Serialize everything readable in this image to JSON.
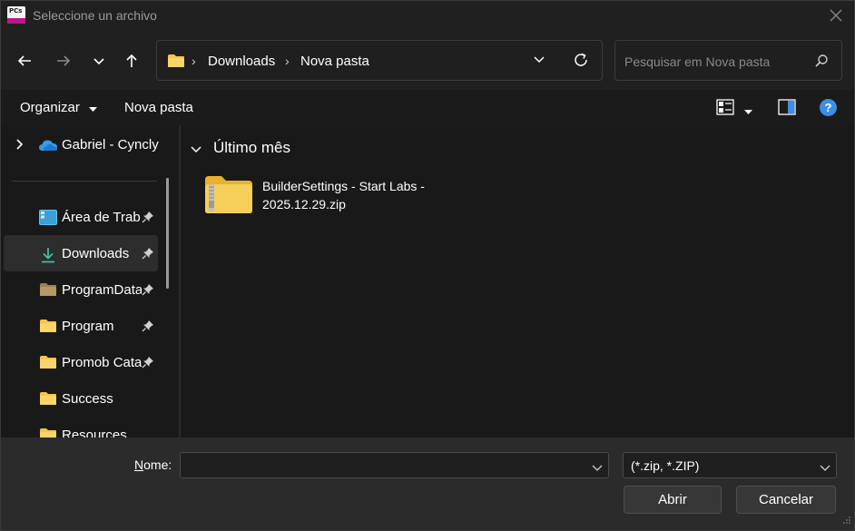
{
  "window": {
    "title": "Seleccione un archivo"
  },
  "address": {
    "crumbs": [
      "Downloads",
      "Nova pasta"
    ]
  },
  "search": {
    "placeholder": "Pesquisar em Nova pasta"
  },
  "toolbar": {
    "organize_label": "Organizar",
    "new_folder_label": "Nova pasta"
  },
  "sidebar": {
    "top_item": {
      "label": "Gabriel - Cyncly",
      "icon": "onedrive-cloud-icon"
    },
    "items": [
      {
        "label": "Área de Trab",
        "icon": "desktop-icon",
        "pinned": true,
        "active": false
      },
      {
        "label": "Downloads",
        "icon": "download-icon",
        "pinned": true,
        "active": true
      },
      {
        "label": "ProgramData",
        "icon": "folder-icon",
        "pinned": true,
        "active": false
      },
      {
        "label": "Program",
        "icon": "folder-icon",
        "pinned": true,
        "active": false
      },
      {
        "label": "Promob Cata",
        "icon": "folder-icon",
        "pinned": true,
        "active": false
      },
      {
        "label": "Success",
        "icon": "folder-icon",
        "pinned": false,
        "active": false
      },
      {
        "label": "Resources",
        "icon": "folder-icon",
        "pinned": false,
        "active": false
      }
    ]
  },
  "main": {
    "group_label": "Último mês",
    "files": [
      {
        "name_line1": "BuilderSettings - Start Labs -",
        "name_line2": "2025.12.29.zip",
        "icon": "zip-folder-icon"
      }
    ]
  },
  "footer": {
    "name_label_underlined": "N",
    "name_label_rest": "ome:",
    "name_value": "",
    "file_type": "(*.zip, *.ZIP)",
    "open_label": "Abrir",
    "cancel_label": "Cancelar"
  },
  "colors": {
    "accent": "#3a8ee6",
    "folder": "#f4c44e",
    "background": "#191919"
  }
}
